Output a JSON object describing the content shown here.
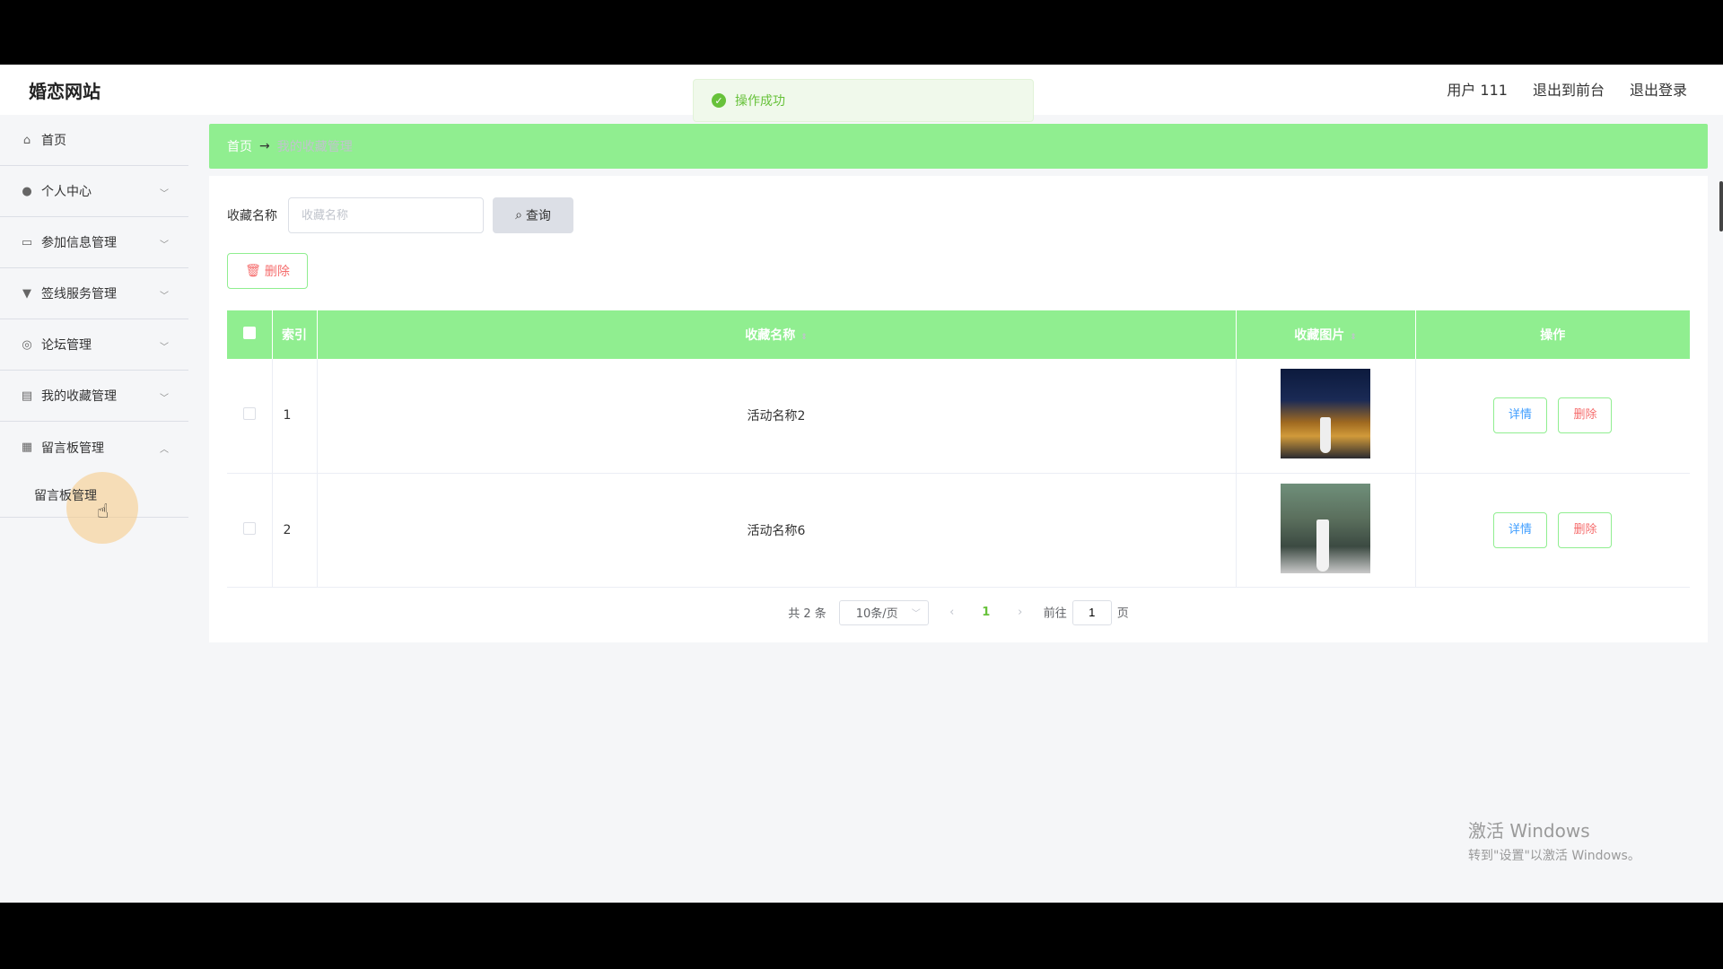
{
  "header": {
    "brand": "婚恋网站",
    "user": "用户 111",
    "back_front": "退出到前台",
    "logout": "退出登录"
  },
  "toast": {
    "text": "操作成功"
  },
  "sidebar": {
    "items": [
      {
        "label": "首页",
        "icon": "home-icon"
      },
      {
        "label": "个人中心",
        "icon": "user-icon"
      },
      {
        "label": "参加信息管理",
        "icon": "message-icon"
      },
      {
        "label": "签线服务管理",
        "icon": "service-icon"
      },
      {
        "label": "论坛管理",
        "icon": "forum-icon"
      },
      {
        "label": "我的收藏管理",
        "icon": "collection-icon"
      },
      {
        "label": "留言板管理",
        "icon": "grid-icon"
      }
    ],
    "submenu": "留言板管理"
  },
  "breadcrumb": {
    "home": "首页",
    "arrow": "→",
    "current": "我的收藏管理"
  },
  "search": {
    "label": "收藏名称",
    "placeholder": "收藏名称",
    "button": "查询"
  },
  "toolbar": {
    "delete": "删除"
  },
  "table": {
    "headers": {
      "index": "索引",
      "name": "收藏名称",
      "image": "收藏图片",
      "ops": "操作"
    },
    "rows": [
      {
        "index": "1",
        "name": "活动名称2"
      },
      {
        "index": "2",
        "name": "活动名称6"
      }
    ],
    "detail": "详情",
    "delete": "删除"
  },
  "pager": {
    "total": "共 2 条",
    "size": "10条/页",
    "page": "1",
    "goto": "前往",
    "goto_value": "1",
    "page_unit": "页"
  },
  "watermark": {
    "line1": "激活 Windows",
    "line2": "转到\"设置\"以激活 Windows。"
  }
}
